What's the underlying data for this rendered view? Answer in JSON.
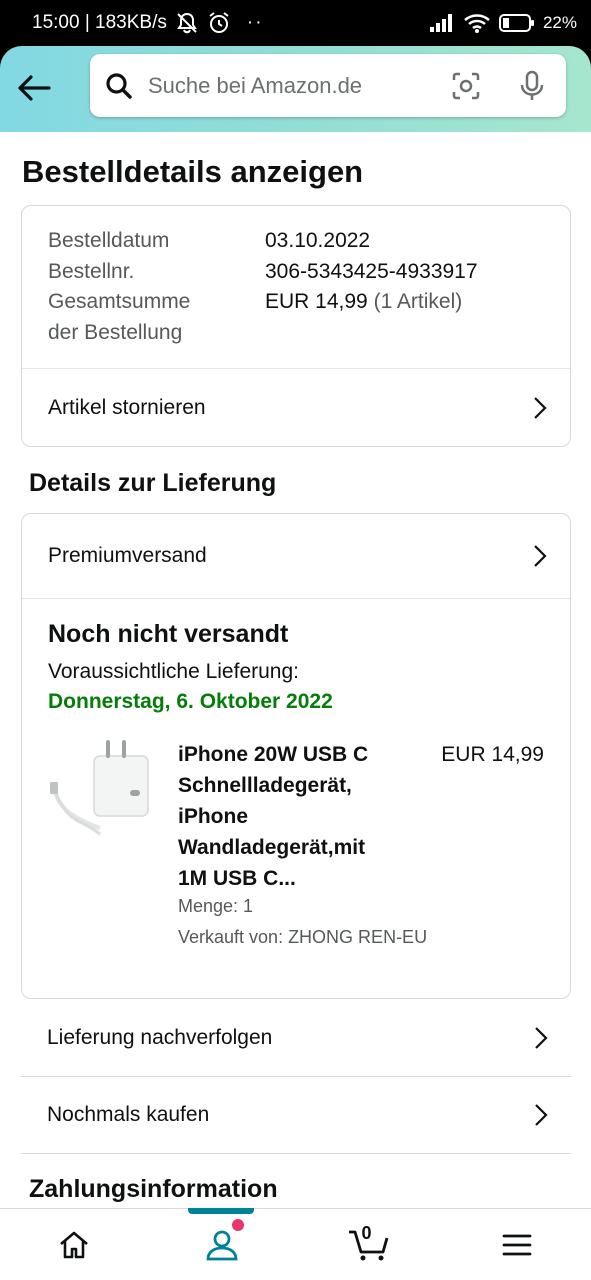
{
  "status_bar": {
    "time_speed": "15:00 | 183KB/s",
    "more": "··",
    "battery": "22%"
  },
  "search": {
    "placeholder": "Suche bei Amazon.de"
  },
  "page": {
    "title": "Bestelldetails anzeigen"
  },
  "order": {
    "date_label": "Bestelldatum",
    "date_value": "03.10.2022",
    "number_label": "Bestellnr.",
    "number_value": "306-5343425-4933917",
    "total_label_line1": "Gesamtsumme",
    "total_label_line2": "der Bestellung",
    "total_value": "EUR 14,99",
    "total_items": "(1 Artikel)",
    "cancel_label": "Artikel stornieren"
  },
  "delivery": {
    "section_title": "Details zur Lieferung",
    "shipping_method": "Premiumversand",
    "status": "Noch nicht versandt",
    "expected_label": "Voraussichtliche Lieferung:",
    "expected_date": "Donnerstag, 6. Oktober 2022",
    "date_color": "#067d0a"
  },
  "product": {
    "title_lines": [
      "iPhone 20W USB C",
      "Schnellladegerät,",
      "iPhone",
      "Wandladegerät,mit",
      "1M USB C..."
    ],
    "price": "EUR 14,99",
    "quantity": "Menge: 1",
    "seller": "Verkauft von: ZHONG REN-EU"
  },
  "actions": {
    "track": "Lieferung nachverfolgen",
    "buy_again": "Nochmals kaufen"
  },
  "payment": {
    "section_title": "Zahlungsinformation"
  },
  "bottom_nav": {
    "cart_count": "0",
    "active_color": "#008296",
    "notification_color": "#e8336b"
  }
}
